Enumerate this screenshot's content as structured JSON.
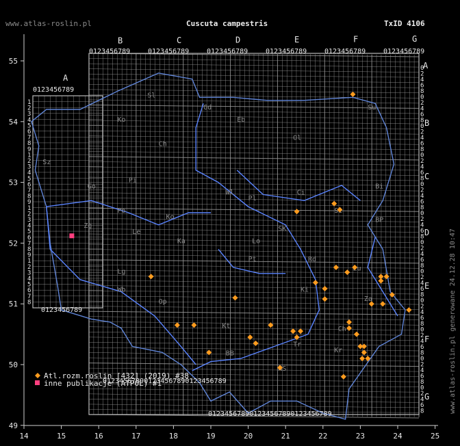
{
  "header": {
    "site": "www.atlas-roslin.pl",
    "species": "Cuscuta campestris",
    "taxon_id": "TxID 4106"
  },
  "side_note": "www.atlas-roslin.pl generowane 24.12.28 10:47",
  "axes": {
    "x_ticks": [
      "14",
      "15",
      "16",
      "17",
      "18",
      "19",
      "20",
      "21",
      "22",
      "23",
      "24",
      "25"
    ],
    "y_ticks": [
      "55",
      "54",
      "53",
      "52",
      "51",
      "50",
      "49"
    ]
  },
  "atpol": {
    "col_letters": [
      "A",
      "B",
      "C",
      "D",
      "E",
      "F",
      "G"
    ],
    "row_letters": [
      "A",
      "B",
      "C",
      "D",
      "E",
      "F",
      "G"
    ],
    "digits_row": "0123456789",
    "digits_col": [
      "0",
      "2",
      "4",
      "6",
      "8"
    ]
  },
  "region_labels": [
    "Sl",
    "Gd",
    "Eb",
    "Ko",
    "Ch",
    "Ol",
    "Su",
    "Sz",
    "Pi",
    "Bi",
    "Ci",
    "Go",
    "Wl",
    "Pl",
    "Po",
    "Ko",
    "Zg",
    "Le",
    "Ka",
    "Si",
    "BP",
    "SK",
    "Lo",
    "Pt",
    "Rd",
    "Lg",
    "Lu",
    "Wb",
    "Ki",
    "Za",
    "Op",
    "Kt",
    "Tr",
    "Kr",
    "BB",
    "NS",
    "Ch"
  ],
  "legend": {
    "items": [
      {
        "label": "Atl.rozm.roslin [432] (2019) #38",
        "color": "#ff9c1f",
        "symbol": "diamond"
      },
      {
        "label": "inne publikacje (ATPOL) #1",
        "color": "#ff3f7f",
        "symbol": "square"
      }
    ]
  },
  "colors": {
    "background": "#000000",
    "grid": "#9a9a9a",
    "border": "#5f84d6",
    "river": "#5a84ff",
    "text": "#e8e8e8",
    "atlas_point": "#ff9c1f",
    "atpol_point": "#ff3f7f"
  },
  "map_points": {
    "atlas": [
      [
        22.8,
        54.45
      ],
      [
        22.3,
        52.65
      ],
      [
        22.45,
        52.55
      ],
      [
        21.3,
        52.52
      ],
      [
        17.4,
        51.45
      ],
      [
        19.65,
        51.1
      ],
      [
        21.8,
        51.35
      ],
      [
        22.05,
        51.25
      ],
      [
        22.05,
        51.08
      ],
      [
        22.35,
        51.6
      ],
      [
        22.85,
        51.6
      ],
      [
        22.65,
        51.52
      ],
      [
        23.55,
        51.45
      ],
      [
        23.7,
        51.45
      ],
      [
        23.55,
        51.38
      ],
      [
        23.85,
        51.15
      ],
      [
        23.3,
        51.0
      ],
      [
        23.6,
        51.0
      ],
      [
        24.3,
        50.9
      ],
      [
        22.7,
        50.7
      ],
      [
        22.7,
        50.6
      ],
      [
        22.9,
        50.5
      ],
      [
        23.0,
        50.3
      ],
      [
        23.1,
        50.3
      ],
      [
        23.1,
        50.2
      ],
      [
        23.2,
        50.1
      ],
      [
        23.05,
        50.1
      ],
      [
        18.1,
        50.65
      ],
      [
        18.55,
        50.65
      ],
      [
        18.95,
        50.2
      ],
      [
        20.05,
        50.45
      ],
      [
        20.2,
        50.35
      ],
      [
        20.6,
        50.65
      ],
      [
        21.2,
        50.55
      ],
      [
        21.4,
        50.55
      ],
      [
        21.3,
        50.45
      ],
      [
        20.85,
        49.95
      ],
      [
        22.55,
        49.8
      ]
    ],
    "atpol": [
      [
        15.28,
        52.12
      ]
    ]
  }
}
